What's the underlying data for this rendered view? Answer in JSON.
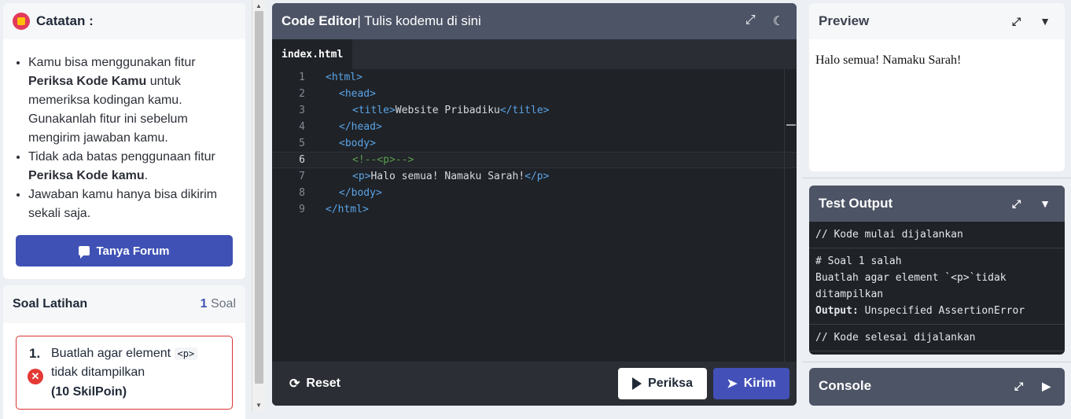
{
  "notes": {
    "title": "Catatan :",
    "items": [
      {
        "pre": "Kamu bisa menggunakan fitur ",
        "bold": "Periksa Kode Kamu",
        "post": " untuk memeriksa kodingan kamu. Gunakanlah fitur ini sebelum mengirim jawaban kamu."
      },
      {
        "pre": "Tidak ada batas penggunaan fitur ",
        "bold": "Periksa Kode kamu",
        "post": "."
      },
      {
        "pre": "Jawaban kamu hanya bisa dikirim sekali saja.",
        "bold": "",
        "post": ""
      }
    ],
    "forum_label": "Tanya Forum"
  },
  "soal": {
    "title": "Soal Latihan",
    "count_num": "1",
    "count_label": " Soal",
    "items": [
      {
        "num": "1.",
        "text_pre": "Buatlah agar element ",
        "code": "<p>",
        "text_post": " tidak ditampilkan",
        "points": "(10 SkilPoin)",
        "status": "wrong"
      }
    ]
  },
  "editor": {
    "title_bold": "Code Editor",
    "title_rest": " | Tulis kodemu di sini",
    "tab": "index.html",
    "active_line": 6,
    "lines": [
      {
        "n": "1",
        "indent": 0,
        "parts": [
          [
            "tg",
            "<html>"
          ]
        ]
      },
      {
        "n": "2",
        "indent": 1,
        "parts": [
          [
            "tg",
            "<head>"
          ]
        ]
      },
      {
        "n": "3",
        "indent": 2,
        "parts": [
          [
            "tg",
            "<title>"
          ],
          [
            "tx",
            "Website Pribadiku"
          ],
          [
            "tg",
            "</title>"
          ]
        ]
      },
      {
        "n": "4",
        "indent": 1,
        "parts": [
          [
            "tg",
            "</head>"
          ]
        ]
      },
      {
        "n": "5",
        "indent": 1,
        "parts": [
          [
            "tg",
            "<body>"
          ]
        ]
      },
      {
        "n": "6",
        "indent": 2,
        "parts": [
          [
            "cm",
            "<!--<p>-->"
          ]
        ]
      },
      {
        "n": "7",
        "indent": 2,
        "parts": [
          [
            "tg",
            "<p>"
          ],
          [
            "tx",
            "Halo semua! Namaku Sarah!"
          ],
          [
            "tg",
            "</p>"
          ]
        ]
      },
      {
        "n": "8",
        "indent": 1,
        "parts": [
          [
            "tg",
            "</body>"
          ]
        ]
      },
      {
        "n": "9",
        "indent": 0,
        "parts": [
          [
            "tg",
            "</html>"
          ]
        ]
      }
    ],
    "reset_label": "Reset",
    "periksa_label": "Periksa",
    "kirim_label": "Kirim"
  },
  "preview": {
    "title": "Preview",
    "content": "Halo semua! Namaku Sarah!"
  },
  "test_output": {
    "title": "Test Output",
    "start": "// Kode mulai dijalankan",
    "result_header": "# Soal 1 salah",
    "result_msg": "Buatlah agar element `<p>`tidak ditampilkan",
    "output_label": "Output:",
    "output_value": " Unspecified AssertionError",
    "end": "// Kode selesai dijalankan"
  },
  "console": {
    "title": "Console"
  }
}
